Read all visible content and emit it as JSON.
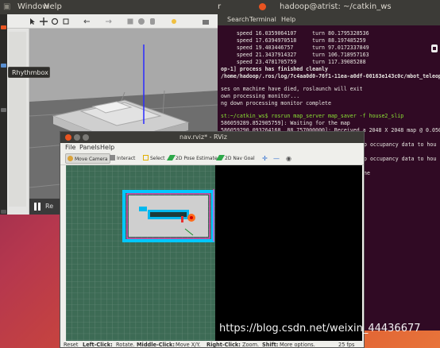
{
  "top_bar": {
    "items": [
      "Window",
      "Help"
    ],
    "right_partial": "r",
    "title": "hadoop@atrist: ~/catkin_ws"
  },
  "launcher": {
    "tooltip": "Rhythmbox"
  },
  "gazebo": {
    "pause_label": "Re"
  },
  "terminal": {
    "title": "hadoop@atrist: ~/catkin_ws",
    "menu": [
      "Search",
      "Terminal",
      "Help"
    ],
    "lines": [
      "     speed 16.0359064107     turn 80.1795328536",
      "     speed 17.6394970518     turn 88.197485259",
      "     speed 19.403446757      turn 97.0172337849",
      "     speed 21.3437914327     turn 106.718957163",
      "     speed 23.4781705759     turn 117.39085288",
      "op-1] process has finished cleanly",
      "/home/hadoop/.ros/log/7c4aa0d0-76f1-11ea-a0df-00163e143c0c/mbot_teleop",
      "",
      "ses on machine have died, roslaunch will exit",
      "own processing monitor...",
      "ng down processing monitor complete",
      "",
      "st:~/catkin_ws$ rosrun map_server map_saver -f house2_slip",
      "586059289.852905759]: Waiting for the map",
      "586059290.093264168, 88.757000000]: Received a 2048 X 2048 map @ 0.050"
    ],
    "right_lines": [
      "p occupancy data to hou",
      "p occupancy data to hou",
      "ne"
    ]
  },
  "rviz": {
    "title": "nav.rviz* - RViz",
    "menu": [
      "File",
      "Panels",
      "Help"
    ],
    "tools": [
      "Move Camera",
      "Interact",
      "Select",
      "2D Pose Estimate",
      "2D Nav Goal"
    ],
    "status": {
      "reset": "Reset",
      "left_key": "Left-Click:",
      "left_text": "Rotate.",
      "mid_key": "Middle-Click:",
      "mid_text": "Move X/Y.",
      "right_key": "Right-Click:",
      "right_text": "Zoom.",
      "shift_key": "Shift:",
      "shift_text": "More options.",
      "fps": "25 fps"
    }
  },
  "watermark": "https://blog.csdn.net/weixin_44436677",
  "colors": {
    "accent": "#e95420",
    "terminal_bg": "#300a24",
    "rviz_grid": "#3d6b55",
    "map_free": "#cfcfcf",
    "costmap": "#00c8ff"
  }
}
